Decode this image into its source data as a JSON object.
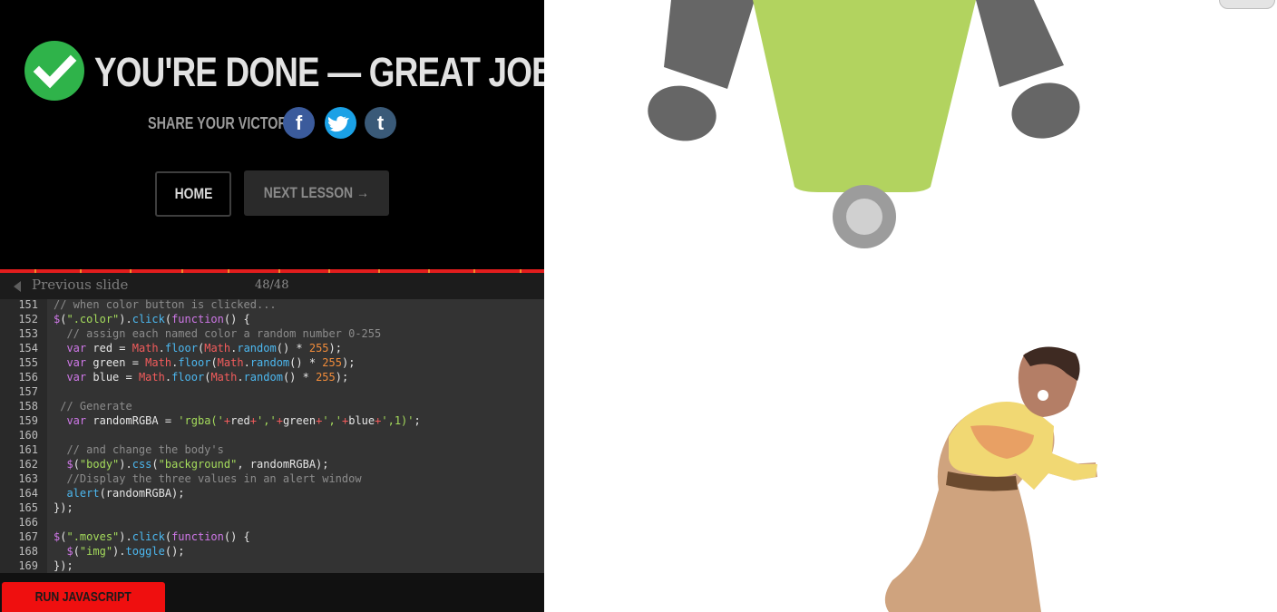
{
  "banner": {
    "title": "YOU'RE DONE — GREAT JOB!",
    "share_label": "SHARE YOUR VICTORY:",
    "social": [
      {
        "name": "facebook",
        "glyph": "f",
        "color": "#3b5b9c"
      },
      {
        "name": "twitter",
        "glyph": "t",
        "color": "#1aa1e6"
      },
      {
        "name": "tumblr",
        "glyph": "t",
        "color": "#3a5a78"
      }
    ],
    "home_label": "HOME",
    "next_label": "NEXT LESSON →",
    "accent": "#2fb34a"
  },
  "slide_bar": {
    "prev_label": "Previous slide",
    "counter": "48/48"
  },
  "code_lines": [
    {
      "n": "151",
      "t": "// when color button is clicked..."
    },
    {
      "n": "152",
      "t": "$(\".color\").click(function() {"
    },
    {
      "n": "153",
      "t": "  // assign each named color a random number 0-255"
    },
    {
      "n": "154",
      "t": "  var red = Math.floor(Math.random() * 255);"
    },
    {
      "n": "155",
      "t": "  var green = Math.floor(Math.random() * 255);"
    },
    {
      "n": "156",
      "t": "  var blue = Math.floor(Math.random() * 255);"
    },
    {
      "n": "157",
      "t": ""
    },
    {
      "n": "158",
      "t": " // Generate"
    },
    {
      "n": "159",
      "t": "  var randomRGBA = 'rgba('+red+','+green+','+blue+',1)';"
    },
    {
      "n": "160",
      "t": ""
    },
    {
      "n": "161",
      "t": "  // and change the body's"
    },
    {
      "n": "162",
      "t": "  $(\"body\").css(\"background\", randomRGBA);"
    },
    {
      "n": "163",
      "t": "  //Display the three values in an alert window"
    },
    {
      "n": "164",
      "t": "  alert(randomRGBA);"
    },
    {
      "n": "165",
      "t": "});"
    },
    {
      "n": "166",
      "t": ""
    },
    {
      "n": "167",
      "t": "$(\".moves\").click(function() {"
    },
    {
      "n": "168",
      "t": "  $(\"img\").toggle();"
    },
    {
      "n": "169",
      "t": "});"
    }
  ],
  "footer": {
    "run_label": "RUN JAVASCRIPT",
    "run_color": "#ef0f0f"
  },
  "preview": {
    "robot_body_color": "#b2d35f",
    "robot_limb_color": "#666666",
    "wheel_color": "#9c9c9c",
    "dancer_image": "dancing-man-image"
  }
}
